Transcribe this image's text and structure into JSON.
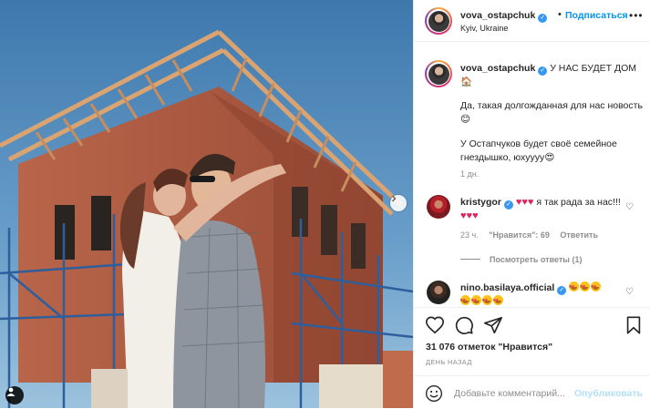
{
  "header": {
    "username": "vova_ostapchuk",
    "separator": "•",
    "follow_label": "Подписаться",
    "location": "Kyiv, Ukraine",
    "more_icon": "more-horizontal-icon"
  },
  "caption": {
    "username": "vova_ostapchuk",
    "line1": "У НАС БУДЕТ ДОМ",
    "line1_emoji": "🏠",
    "para2": "Да, такая долгожданная для нас новость",
    "para2_emoji": "😊",
    "para3": "У Остапчуков будет своё семейное гнездышко, юхуууу",
    "para3_emoji": "😍",
    "time": "1 дн."
  },
  "comments": [
    {
      "username": "kristygor",
      "text_before": "♥♥♥",
      "text": "я так рада за нас!!!",
      "text_after": "♥♥♥",
      "time": "23 ч.",
      "likes_label": "\"Нравится\": 69",
      "reply_label": "Ответить",
      "view_replies": "Посмотреть ответы (1)"
    },
    {
      "username": "nino.basilaya.official",
      "emoji_count": 7
    }
  ],
  "actions": {
    "likes_text": "31 076 отметок \"Нравится\"",
    "date_text": "ДЕНЬ НАЗАД"
  },
  "add_comment": {
    "placeholder": "Добавьте комментарий...",
    "publish_label": "Опубликовать"
  },
  "colors": {
    "accent": "#0095f6",
    "verified": "#3897f0",
    "muted": "#8e8e8e",
    "heart": "#e0245e",
    "publish_disabled": "#b2dffc"
  }
}
